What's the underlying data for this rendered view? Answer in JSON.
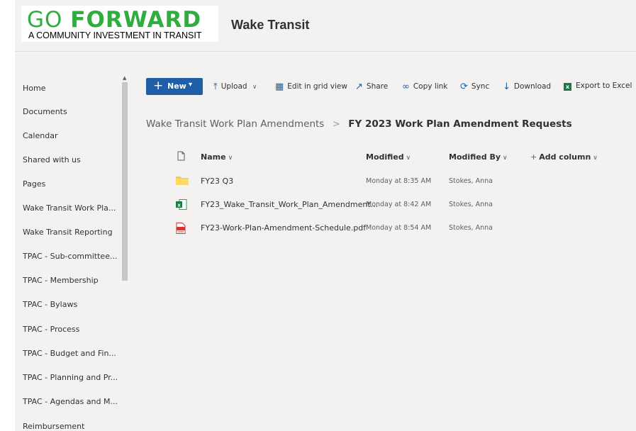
{
  "header": {
    "logo_go": "GO",
    "logo_forward": "FORWARD",
    "logo_tagline": "A COMMUNITY INVESTMENT IN TRANSIT",
    "site_title": "Wake Transit"
  },
  "sidebar": {
    "items": [
      {
        "label": "Home"
      },
      {
        "label": "Documents"
      },
      {
        "label": "Calendar"
      },
      {
        "label": "Shared with us"
      },
      {
        "label": "Pages"
      },
      {
        "label": "Wake Transit Work Pla..."
      },
      {
        "label": "Wake Transit Reporting"
      },
      {
        "label": "TPAC - Sub-committee..."
      },
      {
        "label": "TPAC - Membership"
      },
      {
        "label": "TPAC - Bylaws"
      },
      {
        "label": "TPAC - Process"
      },
      {
        "label": "TPAC - Budget and Fin..."
      },
      {
        "label": "TPAC - Planning and Pr..."
      },
      {
        "label": "TPAC - Agendas and M..."
      },
      {
        "label": "Reimbursement"
      }
    ]
  },
  "command_bar": {
    "new": "New",
    "upload": "Upload",
    "edit_grid": "Edit in grid view",
    "share": "Share",
    "copy_link": "Copy link",
    "sync": "Sync",
    "download": "Download",
    "export_excel": "Export to Excel"
  },
  "breadcrumb": {
    "parent": "Wake Transit Work Plan Amendments",
    "separator": ">",
    "current": "FY 2023 Work Plan Amendment Requests"
  },
  "list": {
    "columns": {
      "name": "Name",
      "modified": "Modified",
      "modified_by": "Modified By",
      "add_column": "Add column"
    },
    "rows": [
      {
        "type": "folder-icon",
        "name": "FY23 Q3",
        "modified": "Monday at 8:35 AM",
        "modified_by": "Stokes, Anna"
      },
      {
        "type": "excel-file-icon",
        "name": "FY23_Wake_Transit_Work_Plan_Amendment...",
        "modified": "Monday at 8:42 AM",
        "modified_by": "Stokes, Anna"
      },
      {
        "type": "pdf-file-icon",
        "name": "FY23-Work-Plan-Amendment-Schedule.pdf",
        "modified": "Monday at 8:54 AM",
        "modified_by": "Stokes, Anna"
      }
    ]
  },
  "colors": {
    "brand_green": "#2fae3f",
    "accent_blue": "#1f5fa8",
    "background": "#f3f2f1"
  }
}
